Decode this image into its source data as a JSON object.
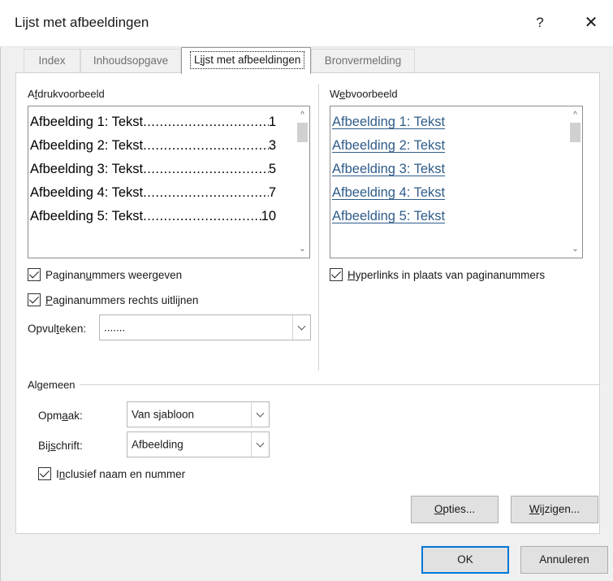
{
  "window": {
    "title": "Lijst met afbeeldingen",
    "help": "?",
    "close": "✕"
  },
  "tabs": [
    {
      "label": "Index"
    },
    {
      "label": "Inhoudsopgave"
    },
    {
      "label_pre": "L",
      "label_u": "i",
      "label_post": "jst met afbeeldingen"
    },
    {
      "label": "Bronvermelding"
    }
  ],
  "print_preview": {
    "label_pre": "A",
    "label_u": "f",
    "label_post": "drukvoorbeeld",
    "entries": [
      {
        "label": "Afbeelding 1: Tekst",
        "page": "1"
      },
      {
        "label": "Afbeelding 2: Tekst",
        "page": "3"
      },
      {
        "label": "Afbeelding 3: Tekst",
        "page": "5"
      },
      {
        "label": "Afbeelding 4: Tekst",
        "page": "7"
      },
      {
        "label": "Afbeelding 5: Tekst",
        "page": "10"
      }
    ]
  },
  "web_preview": {
    "label_pre": "W",
    "label_u": "e",
    "label_post": "bvoorbeeld",
    "entries": [
      "Afbeelding 1: Tekst",
      "Afbeelding 2: Tekst",
      "Afbeelding 3: Tekst",
      "Afbeelding 4: Tekst",
      "Afbeelding 5: Tekst"
    ]
  },
  "options": {
    "show_page_numbers": {
      "pre": "Paginan",
      "u": "u",
      "post": "mmers weergeven",
      "checked": true
    },
    "right_align": {
      "pre": "",
      "u": "P",
      "post": "aginanummers rechts uitlijnen",
      "checked": true
    },
    "tab_leader": {
      "pre": "Opvul",
      "u": "t",
      "post": "eken:",
      "value": "......."
    },
    "hyperlinks": {
      "pre": "",
      "u": "H",
      "post": "yperlinks in plaats van paginanummers",
      "checked": true
    }
  },
  "general": {
    "heading": "Algemeen",
    "format": {
      "pre": "Opm",
      "u": "a",
      "post": "ak:",
      "value": "Van sjabloon"
    },
    "caption": {
      "pre": "Bij",
      "u": "s",
      "post": "chrift:",
      "value": "Afbeelding"
    },
    "include": {
      "pre": "I",
      "u": "n",
      "post": "clusief naam en nummer",
      "checked": true
    }
  },
  "buttons": {
    "options": {
      "pre": "",
      "u": "O",
      "post": "pties..."
    },
    "modify": {
      "pre": "",
      "u": "W",
      "post": "ijzigen..."
    },
    "ok": "OK",
    "cancel": "Annuleren"
  },
  "colors": {
    "accent": "#0078d7",
    "link": "#2e5c8a"
  }
}
